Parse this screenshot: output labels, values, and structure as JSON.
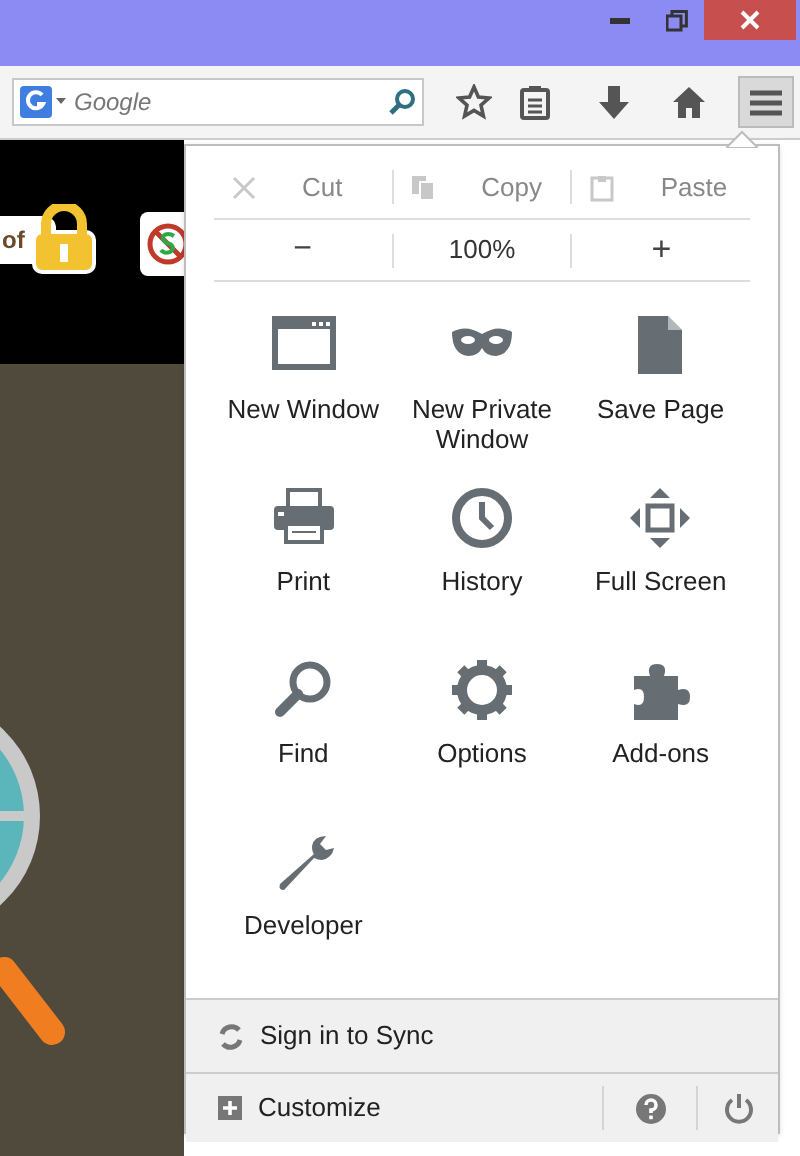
{
  "toolbar": {
    "search": {
      "placeholder": "Google"
    }
  },
  "page": {
    "snippet": "of"
  },
  "menu": {
    "edit": [
      {
        "label": "Cut",
        "kind": "cut",
        "disabled": true
      },
      {
        "label": "Copy",
        "kind": "copy",
        "disabled": true
      },
      {
        "label": "Paste",
        "kind": "paste",
        "disabled": true
      }
    ],
    "zoom": {
      "out": "−",
      "level": "100%",
      "in": "+"
    },
    "items": [
      {
        "label": "New Window",
        "kind": "window"
      },
      {
        "label": "New Private Window",
        "kind": "mask"
      },
      {
        "label": "Save Page",
        "kind": "page"
      },
      {
        "label": "Print",
        "kind": "printer"
      },
      {
        "label": "History",
        "kind": "clock"
      },
      {
        "label": "Full Screen",
        "kind": "fullscreen"
      },
      {
        "label": "Find",
        "kind": "magnifier"
      },
      {
        "label": "Options",
        "kind": "gear"
      },
      {
        "label": "Add-ons",
        "kind": "puzzle"
      },
      {
        "label": "Developer",
        "kind": "wrench"
      }
    ],
    "sync": "Sign in to Sync",
    "customize": "Customize"
  }
}
